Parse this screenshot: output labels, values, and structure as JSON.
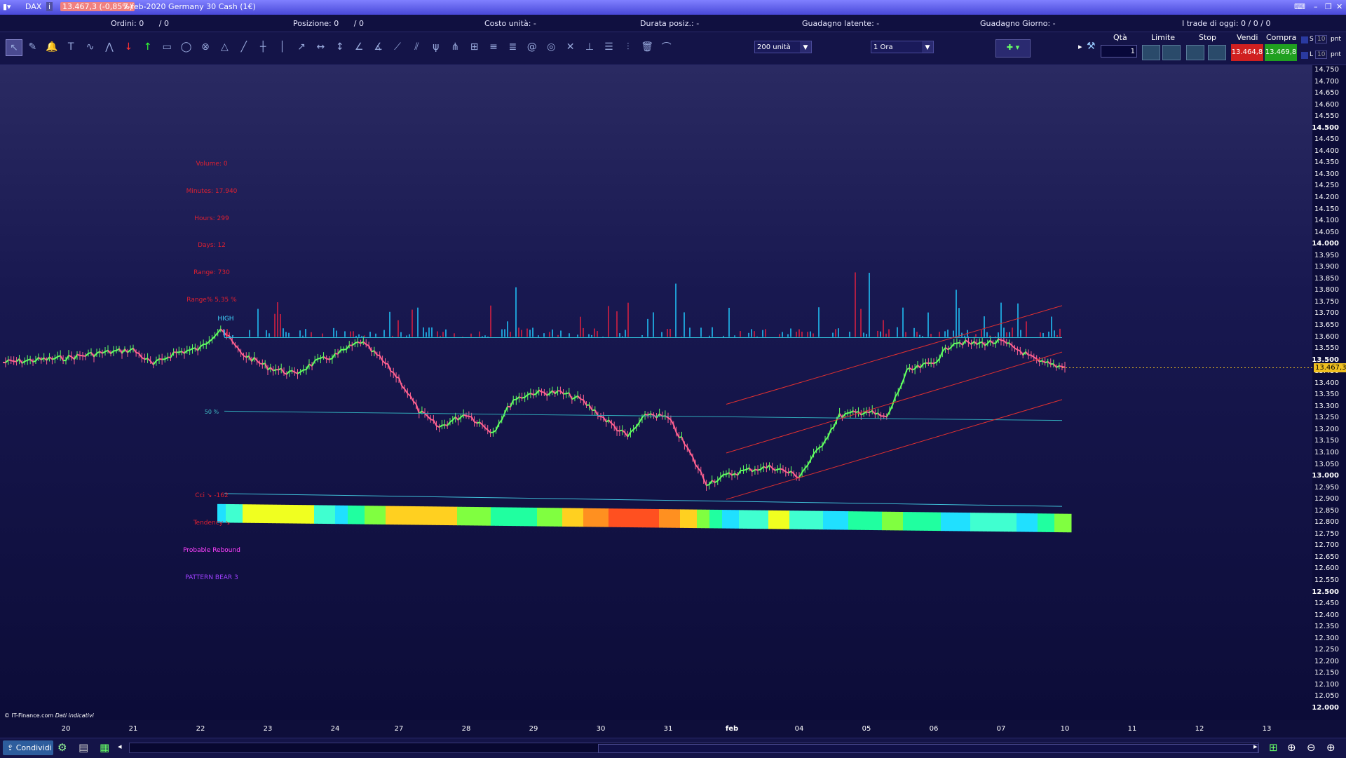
{
  "window": {
    "symbol": "DAX",
    "price_badge": "13.467,3 (-0,85%)",
    "title": "7-feb-2020 Germany 30 Cash (1€)"
  },
  "infobar": {
    "ordini_label": "Ordini:",
    "ordini_value": "0",
    "ordini_total": "/ 0",
    "posizione_label": "Posizione:",
    "posizione_value": "0",
    "posizione_total": "/ 0",
    "costo": "Costo unità: -",
    "durata": "Durata posiz.: -",
    "guadagno_latente": "Guadagno latente: -",
    "guadagno_giorno": "Guadagno Giorno: -",
    "trade_oggi": "I trade di oggi: 0 / 0 / 0"
  },
  "toolbar": {
    "units_select": "200 unità",
    "timeframe_select": "1 Ora",
    "qty_label": "Qtà",
    "qty_value": "1",
    "limit_label": "Limite",
    "stop_label": "Stop",
    "sell_label": "Vendi",
    "buy_label": "Compra",
    "sell_price": "13.464,8",
    "buy_price": "13.469,8",
    "s_label": "S",
    "l_label": "L",
    "s_value": "10",
    "l_value": "10",
    "pnt_label": "pnt"
  },
  "icons": [
    "cursor-icon",
    "pencil-icon",
    "bell-icon",
    "text-icon",
    "indicator-icon",
    "zigzag-icon",
    "arrow-down-icon",
    "arrow-up-icon",
    "rectangle-icon",
    "ellipse-icon",
    "circle-cross-icon",
    "triangle-icon",
    "line-icon",
    "hline-icon",
    "vline-icon",
    "ray-icon",
    "range-icon",
    "vrange-icon",
    "angle-icon",
    "angle2-icon",
    "trendline-icon",
    "channel-icon",
    "pitchfork-icon",
    "fan-icon",
    "grid-icon",
    "fib-icon",
    "fib2-icon",
    "spiral-icon",
    "cycle-icon",
    "wave-icon",
    "lines-icon",
    "lines2-icon",
    "parallel-icon",
    "trash-icon",
    "arc-icon"
  ],
  "stats": {
    "volume": "Volume: 0",
    "minutes": "Minutes: 17.940",
    "hours": "Hours: 299",
    "days": "Days: 12",
    "range": "Range: 730",
    "range_pct": "Range% 5,35 %",
    "high": "HIGH",
    "fifty": "50 %",
    "cci": "Cci ↘ -162",
    "tendency": "Tendency ↘",
    "rebound": "Probable Rebound",
    "pattern": "PATTERN BEAR 3"
  },
  "current_price_label": "13.467,3",
  "chart_data": {
    "type": "line",
    "instrument": "Germany 30 Cash",
    "timeframe": "1 Ora",
    "x_labels": [
      "20",
      "21",
      "22",
      "23",
      "24",
      "27",
      "28",
      "29",
      "30",
      "31",
      "feb",
      "04",
      "05",
      "06",
      "07",
      "10",
      "11",
      "12",
      "13"
    ],
    "y_ticks": [
      "14.750",
      "14.700",
      "14.650",
      "14.600",
      "14.550",
      "14.500",
      "14.450",
      "14.400",
      "14.350",
      "14.300",
      "14.250",
      "14.200",
      "14.150",
      "14.100",
      "14.050",
      "14.000",
      "13.950",
      "13.900",
      "13.850",
      "13.800",
      "13.750",
      "13.700",
      "13.650",
      "13.600",
      "13.550",
      "13.500",
      "13.450",
      "13.400",
      "13.350",
      "13.300",
      "13.250",
      "13.200",
      "13.150",
      "13.100",
      "13.050",
      "13.000",
      "12.950",
      "12.900",
      "12.850",
      "12.800",
      "12.750",
      "12.700",
      "12.650",
      "12.600",
      "12.550",
      "12.500",
      "12.450",
      "12.400",
      "12.350",
      "12.300",
      "12.250",
      "12.200",
      "12.150",
      "12.100",
      "12.050",
      "12.000"
    ],
    "ylim": [
      12000,
      14750
    ],
    "series": [
      {
        "name": "DAX",
        "x": [
          "20",
          "20.5",
          "21",
          "21.3",
          "21.6",
          "22",
          "22.3",
          "22.6",
          "23",
          "23.4",
          "23.7",
          "24",
          "24.4",
          "24.7",
          "27",
          "27.3",
          "27.6",
          "28",
          "28.4",
          "28.7",
          "29",
          "29.4",
          "29.7",
          "30",
          "30.4",
          "30.7",
          "31",
          "31.3",
          "31.6",
          "feb",
          "feb.3",
          "feb.6",
          "04",
          "04.3",
          "04.6",
          "05",
          "05.3",
          "05.6",
          "06",
          "06.3",
          "06.6",
          "07",
          "07.3",
          "07.6",
          "10"
        ],
        "values": [
          13510,
          13530,
          13545,
          13480,
          13530,
          13550,
          13640,
          13530,
          13470,
          13440,
          13490,
          13520,
          13580,
          13510,
          13420,
          13280,
          13210,
          13270,
          13190,
          13330,
          13360,
          13360,
          13330,
          13260,
          13170,
          13270,
          13250,
          13120,
          12970,
          13010,
          13030,
          13040,
          13000,
          13120,
          13260,
          13280,
          13250,
          13450,
          13490,
          13580,
          13570,
          13580,
          13540,
          13490,
          13470
        ]
      }
    ]
  }
}
